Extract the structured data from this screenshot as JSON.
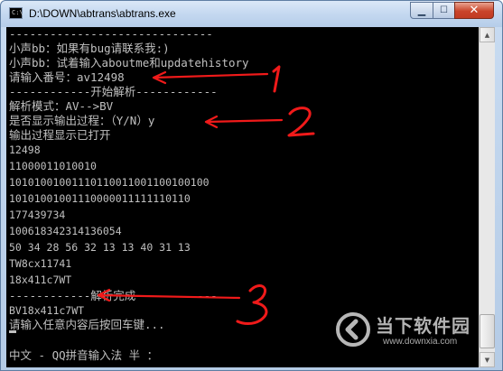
{
  "window": {
    "title": "D:\\DOWN\\abtrans\\abtrans.exe",
    "minimize_glyph": "▁",
    "maximize_glyph": "☐",
    "close_glyph": "✕",
    "icon_text": "C:\\"
  },
  "console": {
    "lines": [
      "------------------------------",
      "小声bb：如果有bug请联系我:)",
      "小声bb：试着输入aboutme和updatehistory",
      "请输入番号：av12498",
      "------------开始解析------------",
      "解析模式：AV-->BV",
      "是否显示输出过程：（Y/N）y",
      "输出过程显示已打开",
      "12498",
      "11000011010010",
      "10101001001110110011001100100100",
      "10101001001110000011111110110",
      "177439734",
      "100618342314136054",
      "50 34 28 56 32 13 13 40 31 13",
      "TW8cx11741",
      "18x411c7WT",
      "------------解析完成------------",
      "BV18x411c7WT",
      "请输入任意内容后按回车键..."
    ],
    "ime_status": "中文 - QQ拼音输入法 半 ："
  },
  "annotations": {
    "color": "#f01a1a",
    "marks": [
      "1",
      "2",
      "3"
    ]
  },
  "watermark": {
    "name": "当下软件园",
    "url": "www.downxia.com"
  }
}
